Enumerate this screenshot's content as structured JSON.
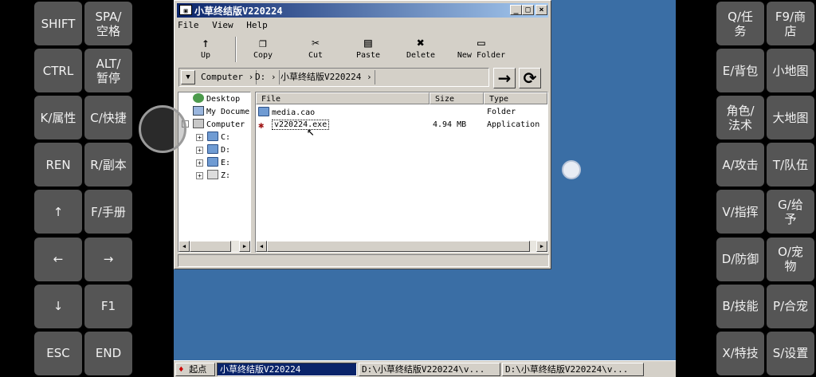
{
  "left_keys": [
    {
      "label": "SHIFT"
    },
    {
      "label": "SPA/\n空格"
    },
    {
      "label": "CTRL"
    },
    {
      "label": "ALT/\n暂停"
    },
    {
      "label": "K/属性"
    },
    {
      "label": "C/快捷"
    },
    {
      "label": "REN"
    },
    {
      "label": "R/副本"
    },
    {
      "label": "↑"
    },
    {
      "label": "F/手册"
    },
    {
      "label": "←"
    },
    {
      "label": "→"
    },
    {
      "label": "↓"
    },
    {
      "label": "F1"
    },
    {
      "label": "ESC"
    },
    {
      "label": "END"
    }
  ],
  "right_keys": [
    {
      "label": "Q/任\n务"
    },
    {
      "label": "F9/商\n店"
    },
    {
      "label": "E/背包"
    },
    {
      "label": "小地图"
    },
    {
      "label": "角色/\n法术"
    },
    {
      "label": "大地图"
    },
    {
      "label": "A/攻击"
    },
    {
      "label": "T/队伍"
    },
    {
      "label": "V/指挥"
    },
    {
      "label": "G/给\n予"
    },
    {
      "label": "D/防御"
    },
    {
      "label": "O/宠\n物"
    },
    {
      "label": "B/技能"
    },
    {
      "label": "P/合宠"
    },
    {
      "label": "X/特技"
    },
    {
      "label": "S/设置"
    }
  ],
  "window": {
    "title": "小草终结版V220224",
    "menu": [
      "File",
      "View",
      "Help"
    ],
    "toolbar": [
      {
        "label": "Up",
        "icon": "↑"
      },
      {
        "label": "Copy",
        "icon": "❐"
      },
      {
        "label": "Cut",
        "icon": "✂"
      },
      {
        "label": "Paste",
        "icon": "▤"
      },
      {
        "label": "Delete",
        "icon": "✖"
      },
      {
        "label": "New Folder",
        "icon": "▭"
      }
    ],
    "address": [
      "Computer",
      "D:",
      "小草终结版V220224"
    ],
    "tree": {
      "desktop": "Desktop",
      "my_documents": "My Docume",
      "computer": "Computer",
      "drives": [
        "C:",
        "D:",
        "E:",
        "Z:"
      ]
    },
    "list": {
      "columns": [
        "File",
        "Size",
        "Type"
      ],
      "rows": [
        {
          "name": "media.cao",
          "size": "",
          "type": "Folder"
        },
        {
          "name": "v220224.exe",
          "size": "4.94 MB",
          "type": "Application"
        }
      ]
    }
  },
  "taskbar": {
    "start": "起点",
    "tasks": [
      "小草终结版V220224",
      "D:\\小草终结版V220224\\v...",
      "D:\\小草终结版V220224\\v..."
    ]
  },
  "colors": {
    "desktop": "#3a6ea5",
    "title": "#0a246a",
    "key": "#555555"
  }
}
